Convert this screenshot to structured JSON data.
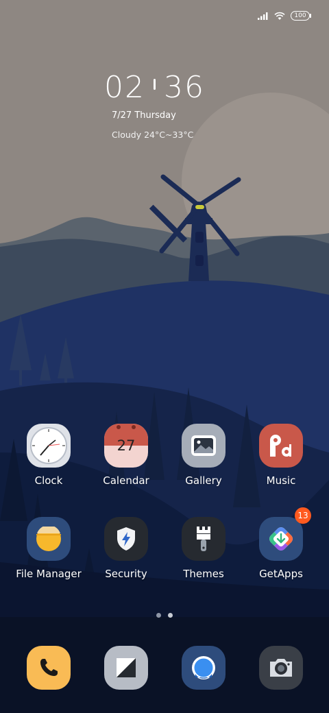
{
  "status_bar": {
    "battery": "100",
    "icons": [
      "signal-icon",
      "wifi-icon",
      "battery-icon"
    ]
  },
  "clock_widget": {
    "hour": "02",
    "minute": "36",
    "date": "7/27 Thursday",
    "weather": "Cloudy 24°C~33°C"
  },
  "apps_row1": [
    {
      "label": "Clock",
      "icon": "clock-icon"
    },
    {
      "label": "Calendar",
      "icon": "calendar-icon",
      "day": "27"
    },
    {
      "label": "Gallery",
      "icon": "gallery-icon"
    },
    {
      "label": "Music",
      "icon": "music-icon"
    }
  ],
  "apps_row2": [
    {
      "label": "File Manager",
      "icon": "folder-icon"
    },
    {
      "label": "Security",
      "icon": "shield-icon"
    },
    {
      "label": "Themes",
      "icon": "brush-icon"
    },
    {
      "label": "GetApps",
      "icon": "getapps-icon",
      "badge": "13"
    }
  ],
  "page_indicator": {
    "pages": 2,
    "current": 2
  },
  "dock": [
    {
      "icon": "phone-icon"
    },
    {
      "icon": "messages-icon"
    },
    {
      "icon": "browser-icon"
    },
    {
      "icon": "camera-icon"
    }
  ],
  "colors": {
    "sky": "#8e8782",
    "hills_far": "#3d4a5c",
    "hills_mid": "#1f3264",
    "hills_near": "#0e1c3d",
    "badge": "#ff5a1f"
  }
}
